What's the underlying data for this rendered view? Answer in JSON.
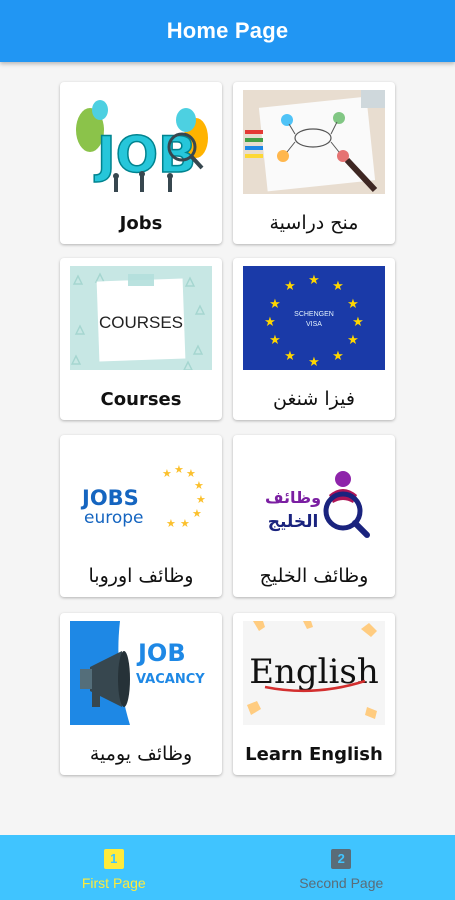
{
  "app_bar": {
    "title": "Home Page"
  },
  "cards": [
    {
      "label": "Jobs",
      "image": "jobs-illustration"
    },
    {
      "label": "منح دراسية",
      "image": "scholarship-sketch"
    },
    {
      "label": "Courses",
      "image": "courses-note"
    },
    {
      "label": "فيزا شنغن",
      "image": "schengen-visa-flag",
      "image_text": [
        "SCHENGEN",
        "VISA"
      ]
    },
    {
      "label": "وظائف اوروبا",
      "image": "jobs-europe-logo",
      "image_text": [
        "JOBS",
        "europe"
      ]
    },
    {
      "label": "وظائف الخليج",
      "image": "gulf-jobs-logo",
      "image_text": [
        "وظائف",
        "الخليج"
      ]
    },
    {
      "label": "وظائف يومية",
      "image": "job-vacancy-megaphone",
      "image_text": [
        "JOB",
        "VACANCY"
      ]
    },
    {
      "label": "Learn English",
      "image": "english-chalkboard",
      "image_text": [
        "English"
      ]
    }
  ],
  "bottom_nav": {
    "items": [
      {
        "icon": "1",
        "label": "First Page",
        "active": true
      },
      {
        "icon": "2",
        "label": "Second Page",
        "active": false
      }
    ]
  },
  "colors": {
    "app_bar": "#2196f3",
    "bottom_nav": "#40c4ff",
    "active": "#ffeb3b",
    "inactive": "#5a6c78"
  }
}
